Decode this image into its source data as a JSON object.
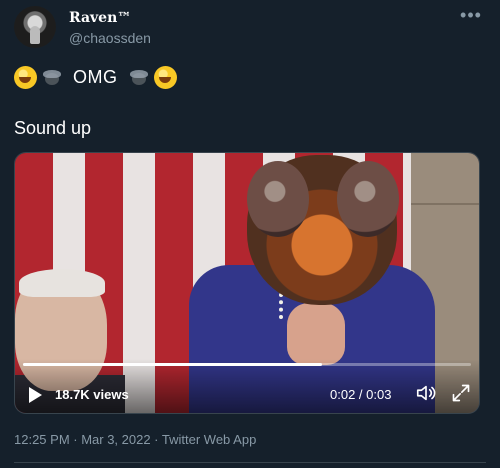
{
  "tweet": {
    "author": {
      "display_name": "Raven™",
      "handle": "@chaossden"
    },
    "text_line1": {
      "prefix_emojis": [
        "rolling-on-floor-laughing",
        "fly"
      ],
      "word": "OMG",
      "suffix_emojis": [
        "fly",
        "rolling-on-floor-laughing"
      ]
    },
    "text_line2": "Sound up",
    "video": {
      "views": "18.7K views",
      "time_current": "0:02",
      "time_total": "0:03",
      "time_display": "0:02 / 0:03",
      "progress_fraction": 0.667
    },
    "meta": "12:25 PM · Mar 3, 2022 · Twitter Web App"
  },
  "icons": {
    "more": "more-horizontal-icon",
    "play": "play-icon",
    "volume": "volume-icon",
    "fullscreen": "expand-icon"
  },
  "colors": {
    "background": "#15202b",
    "secondary_text": "#8899a6",
    "border": "#38444d"
  }
}
